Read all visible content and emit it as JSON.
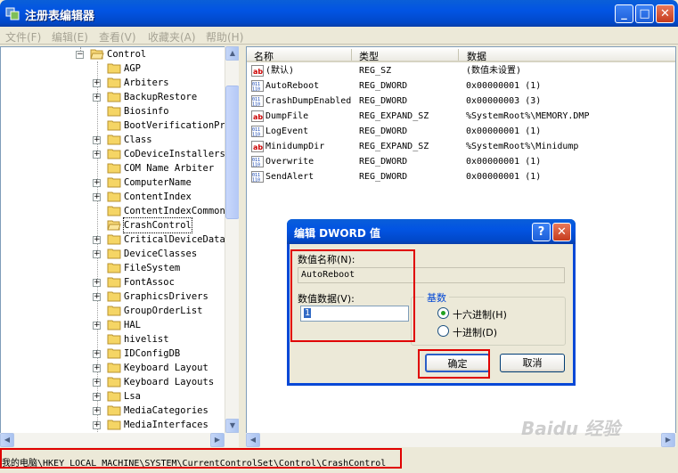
{
  "window": {
    "title": "注册表编辑器"
  },
  "titlebar_buttons": {
    "minimize": "_",
    "maximize": "□",
    "close": "✕"
  },
  "menu": [
    {
      "label": "文件(F)"
    },
    {
      "label": "编辑(E)"
    },
    {
      "label": "查看(V)"
    },
    {
      "label": "收藏夹(A)"
    },
    {
      "label": "帮助(H)"
    }
  ],
  "tree": {
    "parent": "Control",
    "items": [
      {
        "label": "AGP",
        "expandable": false
      },
      {
        "label": "Arbiters",
        "expandable": true
      },
      {
        "label": "BackupRestore",
        "expandable": true
      },
      {
        "label": "Biosinfo",
        "expandable": false
      },
      {
        "label": "BootVerificationPro",
        "expandable": false
      },
      {
        "label": "Class",
        "expandable": true
      },
      {
        "label": "CoDeviceInstallers",
        "expandable": true
      },
      {
        "label": "COM Name Arbiter",
        "expandable": false
      },
      {
        "label": "ComputerName",
        "expandable": true
      },
      {
        "label": "ContentIndex",
        "expandable": true
      },
      {
        "label": "ContentIndexCommon",
        "expandable": false
      },
      {
        "label": "CrashControl",
        "expandable": false,
        "selected": true
      },
      {
        "label": "CriticalDeviceDatab",
        "expandable": true
      },
      {
        "label": "DeviceClasses",
        "expandable": true
      },
      {
        "label": "FileSystem",
        "expandable": false
      },
      {
        "label": "FontAssoc",
        "expandable": true
      },
      {
        "label": "GraphicsDrivers",
        "expandable": true
      },
      {
        "label": "GroupOrderList",
        "expandable": false
      },
      {
        "label": "HAL",
        "expandable": true
      },
      {
        "label": "hivelist",
        "expandable": false
      },
      {
        "label": "IDConfigDB",
        "expandable": true
      },
      {
        "label": "Keyboard Layout",
        "expandable": true
      },
      {
        "label": "Keyboard Layouts",
        "expandable": true
      },
      {
        "label": "Lsa",
        "expandable": true
      },
      {
        "label": "MediaCategories",
        "expandable": true
      },
      {
        "label": "MediaInterfaces",
        "expandable": true
      }
    ]
  },
  "list": {
    "columns": [
      "名称",
      "类型",
      "数据"
    ],
    "rows": [
      {
        "icon": "string",
        "name": "(默认)",
        "type": "REG_SZ",
        "data": "(数值未设置)"
      },
      {
        "icon": "binary",
        "name": "AutoReboot",
        "type": "REG_DWORD",
        "data": "0x00000001 (1)"
      },
      {
        "icon": "binary",
        "name": "CrashDumpEnabled",
        "type": "REG_DWORD",
        "data": "0x00000003 (3)"
      },
      {
        "icon": "string",
        "name": "DumpFile",
        "type": "REG_EXPAND_SZ",
        "data": "%SystemRoot%\\MEMORY.DMP"
      },
      {
        "icon": "binary",
        "name": "LogEvent",
        "type": "REG_DWORD",
        "data": "0x00000001 (1)"
      },
      {
        "icon": "string",
        "name": "MinidumpDir",
        "type": "REG_EXPAND_SZ",
        "data": "%SystemRoot%\\Minidump"
      },
      {
        "icon": "binary",
        "name": "Overwrite",
        "type": "REG_DWORD",
        "data": "0x00000001 (1)"
      },
      {
        "icon": "binary",
        "name": "SendAlert",
        "type": "REG_DWORD",
        "data": "0x00000001 (1)"
      }
    ]
  },
  "dialog": {
    "title": "编辑 DWORD 值",
    "help_label": "?",
    "close_label": "✕",
    "value_name_label": "数值名称(N):",
    "value_name": "AutoReboot",
    "value_data_label": "数值数据(V):",
    "value_data": "1",
    "base_label": "基数",
    "hex_label": "十六进制(H)",
    "dec_label": "十进制(D)",
    "base_selected": "hex",
    "ok_label": "确定",
    "cancel_label": "取消"
  },
  "status": {
    "path": "我的电脑\\HKEY_LOCAL_MACHINE\\SYSTEM\\CurrentControlSet\\Control\\CrashControl"
  },
  "watermark": {
    "text": "Baidu 经验"
  },
  "colors": {
    "titlebar": "#0254e3",
    "highlight_box": "#e00000",
    "group_label": "#0046d5"
  }
}
